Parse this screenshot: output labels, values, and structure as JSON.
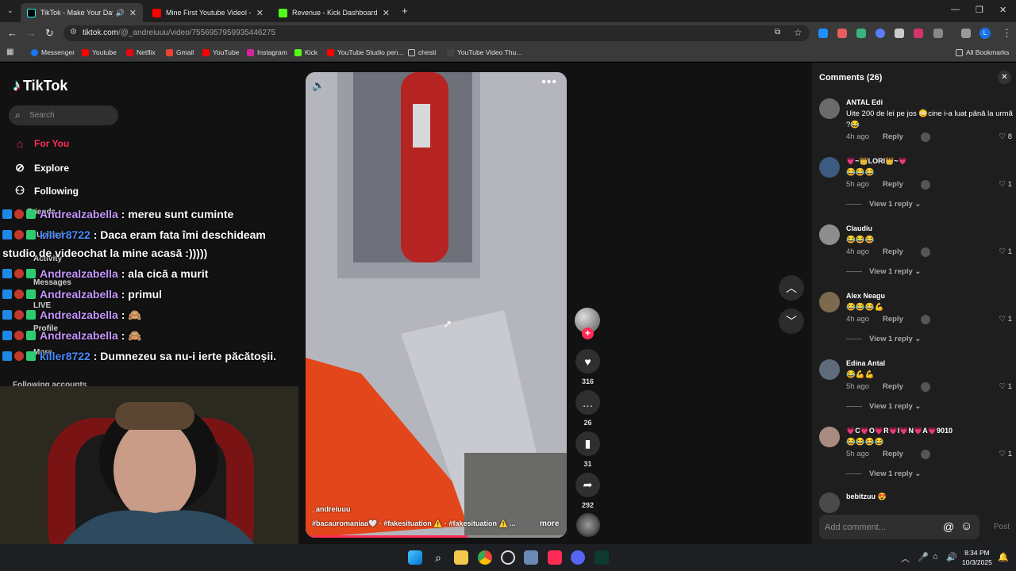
{
  "browser": {
    "tabs": [
      {
        "title": "TikTok - Make Your Day",
        "active": true
      },
      {
        "title": "Mine First Youtube Videol - You",
        "active": false
      },
      {
        "title": "Revenue - Kick Dashboard",
        "active": false
      }
    ],
    "url_host": "tiktok.com",
    "url_path": "/@_andreiuuu/video/7556957959935446275",
    "bookmarks": [
      "Messenger",
      "Youtube",
      "Netflix",
      "Gmail",
      "YouTube",
      "Instagram",
      "Kick",
      "YouTube Studio pen...",
      "chesti",
      "YouTube Video Thu..."
    ],
    "all_bookmarks": "All Bookmarks",
    "profile_initial": "L"
  },
  "sidebar": {
    "logo": "TikTok",
    "search_placeholder": "Search",
    "nav": [
      {
        "label": "For You",
        "icon": "home-icon"
      },
      {
        "label": "Explore",
        "icon": "compass-icon"
      },
      {
        "label": "Following",
        "icon": "following-icon"
      }
    ],
    "nav_obscured": [
      "Friends",
      "Upload",
      "Activity",
      "Messages",
      "LIVE",
      "Profile",
      "More"
    ],
    "following_accounts": "Following accounts"
  },
  "chat": [
    {
      "user": "Andrealzabella",
      "user_prefix": "",
      "message": ": mereu sunt cuminte",
      "color": "u1"
    },
    {
      "user": "killer8722",
      "user_prefix": "",
      "message": ": Daca eram fata îmi deschideam",
      "color": "u2",
      "continuation": "studio de videochat la mine acasă :)))))"
    },
    {
      "user": "Andrealzabella",
      "user_prefix": "",
      "message": ": ala cică a murit",
      "color": "u1"
    },
    {
      "user": "Andrealzabella",
      "user_prefix": "",
      "message": ": primul",
      "color": "u1"
    },
    {
      "user": "Andrealzabella",
      "user_prefix": "",
      "message": ": 🙈",
      "color": "u1"
    },
    {
      "user": "Andrealzabella",
      "user_prefix": "",
      "message": ": 🙈",
      "color": "u1"
    },
    {
      "user": "killer8722",
      "user_prefix": "",
      "message": ": Dumnezeu sa nu-i ierte păcătoșii.",
      "color": "u2"
    }
  ],
  "video": {
    "author": "_andreiuuu",
    "caption": "#bacauromaniaa🤍 · #fakesituation ⚠️ · #fakesituation ⚠️ ...",
    "more": "more",
    "progress": 0.62,
    "likes": "316",
    "comments": "26",
    "saves": "31",
    "shares": "292"
  },
  "comments_panel": {
    "title": "Comments (26)",
    "items": [
      {
        "name": "ANTAL Edi",
        "text": "Uite 200 de lei pe jos 😳cine i-a luat până la urmă ?😂",
        "time": "4h ago",
        "likes": "8",
        "replies": ""
      },
      {
        "name": "💗~👑LORI👑~💗",
        "text": "😂😂😂",
        "time": "5h ago",
        "likes": "1",
        "replies": "View 1 reply"
      },
      {
        "name": "Claudiu",
        "text": "😂😂😂",
        "time": "4h ago",
        "likes": "1",
        "replies": "View 1 reply"
      },
      {
        "name": "Alex Neagu",
        "text": "😂😂😂💪",
        "time": "4h ago",
        "likes": "1",
        "replies": "View 1 reply"
      },
      {
        "name": "Edina Antal",
        "text": "😂💪💪",
        "time": "5h ago",
        "likes": "1",
        "replies": "View 1 reply"
      },
      {
        "name": "💗C💗O💗R💗I💗N💗A💗9010",
        "text": "😂😂😂😂",
        "time": "5h ago",
        "likes": "1",
        "replies": "View 1 reply"
      },
      {
        "name": "bebitzuu 😍",
        "text": "",
        "time": "",
        "likes": "",
        "replies": ""
      }
    ],
    "reply_label": "Reply",
    "add_placeholder": "Add comment...",
    "post_label": "Post"
  },
  "taskbar": {
    "time": "8:34 PM",
    "date": "10/3/2025"
  },
  "colors": {
    "accent": "#fe2c55",
    "panel": "#1e1e1e",
    "bg": "#121212"
  }
}
